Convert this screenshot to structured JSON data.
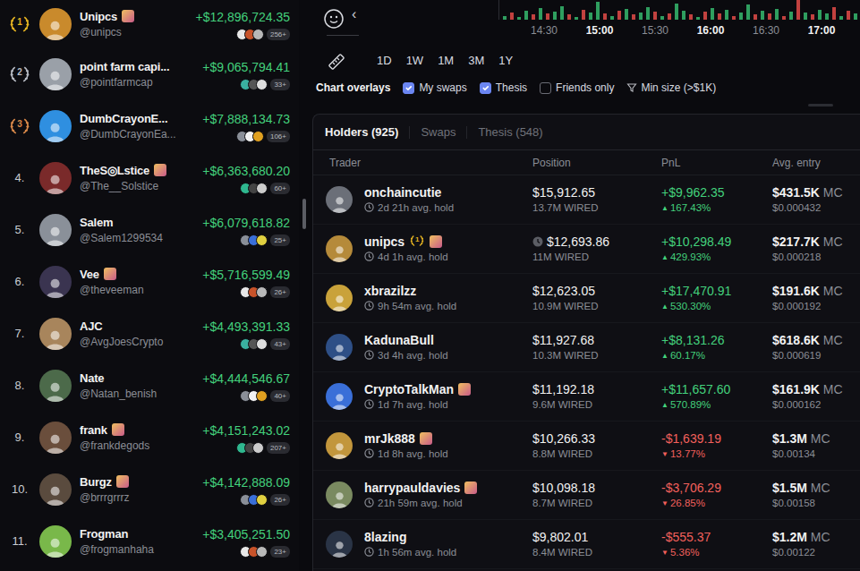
{
  "leaderboard": [
    {
      "rank": "1",
      "medal": true,
      "color": "#e6b422",
      "name": "Unipcs",
      "handle": "@unipcs",
      "pnl": "+$12,896,724.35",
      "count": "256+",
      "badge": true
    },
    {
      "rank": "2",
      "medal": true,
      "color": "#b8bcc4",
      "name": "point farm capi...",
      "handle": "@pointfarmcap",
      "pnl": "+$9,065,794.41",
      "count": "33+",
      "badge": false
    },
    {
      "rank": "3",
      "medal": true,
      "color": "#d8894a",
      "name": "DumbCrayonE...",
      "handle": "@DumbCrayonEa...",
      "pnl": "+$7,888,134.73",
      "count": "106+",
      "badge": false
    },
    {
      "rank": "4.",
      "medal": false,
      "color": "#c9ccd2",
      "name": "TheS◎Lstice",
      "handle": "@The__Solstice",
      "pnl": "+$6,363,680.20",
      "count": "60+",
      "badge": true
    },
    {
      "rank": "5.",
      "medal": false,
      "color": "#c9ccd2",
      "name": "Salem",
      "handle": "@Salem1299534",
      "pnl": "+$6,079,618.82",
      "count": "25+",
      "badge": false
    },
    {
      "rank": "6.",
      "medal": false,
      "color": "#c9ccd2",
      "name": "Vee",
      "handle": "@theveeman",
      "pnl": "+$5,716,599.49",
      "count": "26+",
      "badge": true
    },
    {
      "rank": "7.",
      "medal": false,
      "color": "#c9ccd2",
      "name": "AJC",
      "handle": "@AvgJoesCrypto",
      "pnl": "+$4,493,391.33",
      "count": "43+",
      "badge": false
    },
    {
      "rank": "8.",
      "medal": false,
      "color": "#c9ccd2",
      "name": "Nate",
      "handle": "@Natan_benish",
      "pnl": "+$4,444,546.67",
      "count": "40+",
      "badge": false
    },
    {
      "rank": "9.",
      "medal": false,
      "color": "#c9ccd2",
      "name": "frank",
      "handle": "@frankdegods",
      "pnl": "+$4,151,243.02",
      "count": "207+",
      "badge": true
    },
    {
      "rank": "10.",
      "medal": false,
      "color": "#c9ccd2",
      "name": "Burgz",
      "handle": "@brrrgrrrz",
      "pnl": "+$4,142,888.09",
      "count": "26+",
      "badge": true
    },
    {
      "rank": "11.",
      "medal": false,
      "color": "#c9ccd2",
      "name": "Frogman",
      "handle": "@frogmanhaha",
      "pnl": "+$3,405,251.50",
      "count": "23+",
      "badge": false
    }
  ],
  "chart": {
    "arrow": "‹",
    "bars": [
      {
        "value": 4,
        "up": true
      },
      {
        "value": 7,
        "up": false
      },
      {
        "value": 3,
        "up": true
      },
      {
        "value": 9,
        "up": true
      },
      {
        "value": 5,
        "up": false
      },
      {
        "value": 12,
        "up": true
      },
      {
        "value": 6,
        "up": false
      },
      {
        "value": 8,
        "up": true
      },
      {
        "value": 14,
        "up": true
      },
      {
        "value": 5,
        "up": false
      },
      {
        "value": 3,
        "up": true
      },
      {
        "value": 10,
        "up": false
      },
      {
        "value": 7,
        "up": true
      },
      {
        "value": 18,
        "up": true
      },
      {
        "value": 6,
        "up": false
      },
      {
        "value": 4,
        "up": true
      },
      {
        "value": 9,
        "up": false
      },
      {
        "value": 11,
        "up": true
      },
      {
        "value": 5,
        "up": false
      },
      {
        "value": 7,
        "up": true
      },
      {
        "value": 13,
        "up": true
      },
      {
        "value": 8,
        "up": false
      },
      {
        "value": 4,
        "up": true
      },
      {
        "value": 6,
        "up": false
      },
      {
        "value": 16,
        "up": true
      },
      {
        "value": 9,
        "up": true
      },
      {
        "value": 5,
        "up": false
      },
      {
        "value": 3,
        "up": true
      },
      {
        "value": 8,
        "up": false
      },
      {
        "value": 12,
        "up": true
      },
      {
        "value": 6,
        "up": false
      },
      {
        "value": 10,
        "up": true
      },
      {
        "value": 4,
        "up": false
      },
      {
        "value": 7,
        "up": true
      },
      {
        "value": 15,
        "up": true
      },
      {
        "value": 5,
        "up": false
      },
      {
        "value": 9,
        "up": true
      },
      {
        "value": 6,
        "up": false
      },
      {
        "value": 11,
        "up": true
      },
      {
        "value": 4,
        "up": false
      },
      {
        "value": 8,
        "up": true
      },
      {
        "value": 20,
        "up": false
      },
      {
        "value": 7,
        "up": true
      },
      {
        "value": 5,
        "up": false
      },
      {
        "value": 10,
        "up": true
      },
      {
        "value": 6,
        "up": true
      },
      {
        "value": 13,
        "up": false
      },
      {
        "value": 4,
        "up": true
      },
      {
        "value": 9,
        "up": false
      },
      {
        "value": 6,
        "up": true
      }
    ],
    "ticks": [
      {
        "label": "14:30",
        "bold": false
      },
      {
        "label": "15:00",
        "bold": true
      },
      {
        "label": "15:30",
        "bold": false
      },
      {
        "label": "16:00",
        "bold": true
      },
      {
        "label": "16:30",
        "bold": false
      },
      {
        "label": "17:00",
        "bold": true
      }
    ]
  },
  "timeframes": [
    {
      "label": "1D",
      "selected": false
    },
    {
      "label": "1W",
      "selected": false
    },
    {
      "label": "1M",
      "selected": false
    },
    {
      "label": "3M",
      "selected": false
    },
    {
      "label": "1Y",
      "selected": false
    }
  ],
  "overlays": {
    "title": "Chart overlays",
    "items": [
      {
        "kind": "checkbox",
        "label": "My swaps",
        "checked": true
      },
      {
        "kind": "checkbox",
        "label": "Thesis",
        "checked": true
      },
      {
        "kind": "checkbox",
        "label": "Friends only",
        "checked": false
      },
      {
        "kind": "filter",
        "label": "Min size (>$1K)",
        "checked": false
      }
    ]
  },
  "tabs": [
    {
      "label": "Holders (925)",
      "selected": true
    },
    {
      "label": "Swaps",
      "selected": false
    },
    {
      "label": "Thesis (548)",
      "selected": false
    }
  ],
  "table": {
    "columns": [
      "Trader",
      "Position",
      "PnL",
      "Avg. entry"
    ],
    "rows": [
      {
        "trader": "onchaincutie",
        "badge": false,
        "laurel": false,
        "hold": "2d 21h avg. hold",
        "position": "$15,912.65",
        "position_icon": false,
        "amount": "13.7M WIRED",
        "pnl": "+$9,962.35",
        "positive": true,
        "arrow": "▲",
        "pct": "167.43%",
        "entry_mc": "$431.5K",
        "entry_unit": "MC",
        "entry_price": "$0.000432"
      },
      {
        "trader": "unipcs",
        "badge": true,
        "laurel": true,
        "laurel_text": "1",
        "hold": "4d 1h avg. hold",
        "position": "$12,693.86",
        "position_icon": true,
        "amount": "11M WIRED",
        "pnl": "+$10,298.49",
        "positive": true,
        "arrow": "▲",
        "pct": "429.93%",
        "entry_mc": "$217.7K",
        "entry_unit": "MC",
        "entry_price": "$0.000218"
      },
      {
        "trader": "xbrazilzz",
        "badge": false,
        "laurel": false,
        "hold": "9h 54m avg. hold",
        "position": "$12,623.05",
        "position_icon": false,
        "amount": "10.9M WIRED",
        "pnl": "+$17,470.91",
        "positive": true,
        "arrow": "▲",
        "pct": "530.30%",
        "entry_mc": "$191.6K",
        "entry_unit": "MC",
        "entry_price": "$0.000192"
      },
      {
        "trader": "KadunaBull",
        "badge": false,
        "laurel": false,
        "hold": "3d 4h avg. hold",
        "position": "$11,927.68",
        "position_icon": false,
        "amount": "10.3M WIRED",
        "pnl": "+$8,131.26",
        "positive": true,
        "arrow": "▲",
        "pct": "60.17%",
        "entry_mc": "$618.6K",
        "entry_unit": "MC",
        "entry_price": "$0.000619"
      },
      {
        "trader": "CryptoTalkMan",
        "badge": true,
        "laurel": false,
        "hold": "1d 7h avg. hold",
        "position": "$11,192.18",
        "position_icon": false,
        "amount": "9.6M WIRED",
        "pnl": "+$11,657.60",
        "positive": true,
        "arrow": "▲",
        "pct": "570.89%",
        "entry_mc": "$161.9K",
        "entry_unit": "MC",
        "entry_price": "$0.000162"
      },
      {
        "trader": "mrJk888",
        "badge": true,
        "laurel": false,
        "hold": "1d 8h avg. hold",
        "position": "$10,266.33",
        "position_icon": false,
        "amount": "8.8M WIRED",
        "pnl": "-$1,639.19",
        "positive": false,
        "arrow": "▼",
        "pct": "13.77%",
        "entry_mc": "$1.3M",
        "entry_unit": "MC",
        "entry_price": "$0.00134"
      },
      {
        "trader": "harrypauldavies",
        "badge": true,
        "laurel": false,
        "hold": "21h 59m avg. hold",
        "position": "$10,098.18",
        "position_icon": false,
        "amount": "8.7M WIRED",
        "pnl": "-$3,706.29",
        "positive": false,
        "arrow": "▼",
        "pct": "26.85%",
        "entry_mc": "$1.5M",
        "entry_unit": "MC",
        "entry_price": "$0.00158"
      },
      {
        "trader": "8lazing",
        "badge": false,
        "laurel": false,
        "hold": "1h 56m avg. hold",
        "position": "$9,802.01",
        "position_icon": false,
        "amount": "8.4M WIRED",
        "pnl": "-$555.37",
        "positive": false,
        "arrow": "▼",
        "pct": "5.36%",
        "entry_mc": "$1.2M",
        "entry_unit": "MC",
        "entry_price": "$0.00122"
      }
    ]
  }
}
